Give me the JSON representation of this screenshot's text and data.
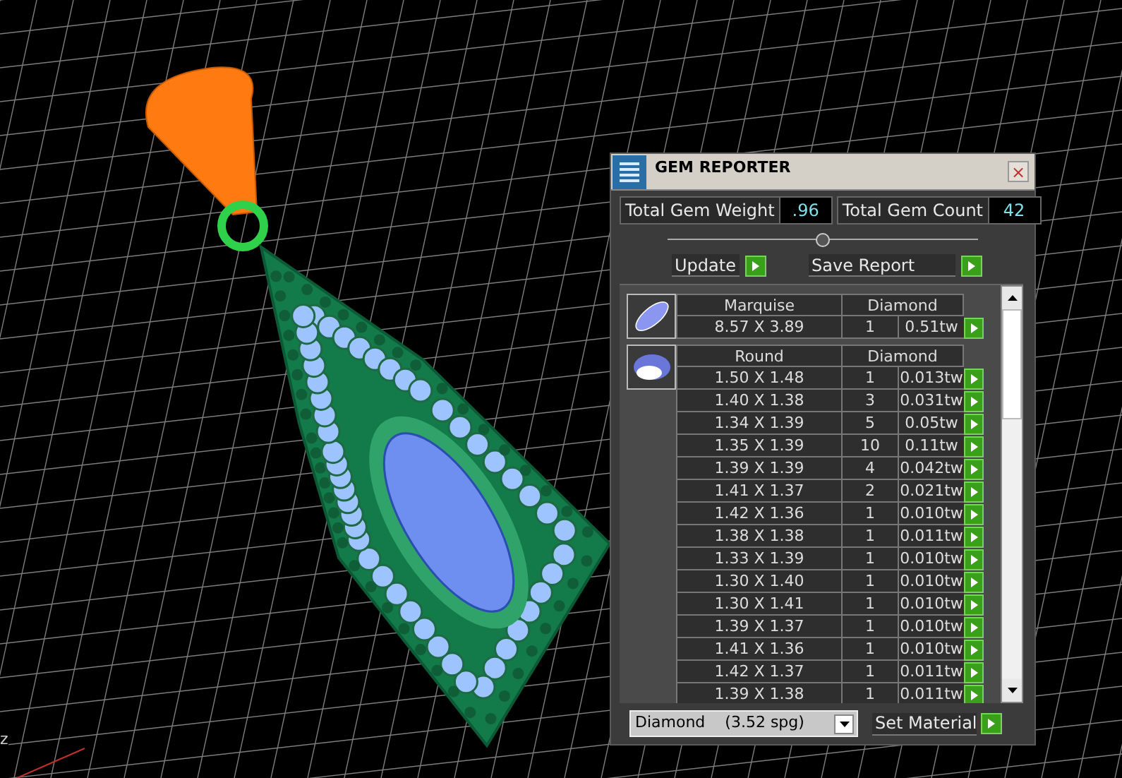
{
  "viewport": {
    "axis_label": "z"
  },
  "panel": {
    "title": "GEM REPORTER",
    "close": "×"
  },
  "totals": [
    {
      "label": "Total Gem Weight",
      "value": ".96"
    },
    {
      "label": "Total Gem Count",
      "value": "42"
    }
  ],
  "slider": {
    "level": 0.5
  },
  "actions": [
    {
      "label": "Update"
    },
    {
      "label": "Save Report"
    }
  ],
  "groups": [
    {
      "shape": "Marquise",
      "material": "Diamond",
      "kind": "marquise",
      "rows": [
        {
          "size": "8.57 X 3.89",
          "count": "1",
          "weight": "0.51tw"
        }
      ]
    },
    {
      "shape": "Round",
      "material": "Diamond",
      "kind": "round",
      "rows": [
        {
          "size": "1.50 X 1.48",
          "count": "1",
          "weight": "0.013tw"
        },
        {
          "size": "1.40 X 1.38",
          "count": "3",
          "weight": "0.031tw"
        },
        {
          "size": "1.34 X 1.39",
          "count": "5",
          "weight": "0.05tw"
        },
        {
          "size": "1.35 X 1.39",
          "count": "10",
          "weight": "0.11tw"
        },
        {
          "size": "1.39 X 1.39",
          "count": "4",
          "weight": "0.042tw"
        },
        {
          "size": "1.41 X 1.37",
          "count": "2",
          "weight": "0.021tw"
        },
        {
          "size": "1.42 X 1.36",
          "count": "1",
          "weight": "0.010tw"
        },
        {
          "size": "1.38 X 1.38",
          "count": "1",
          "weight": "0.011tw"
        },
        {
          "size": "1.33 X 1.39",
          "count": "1",
          "weight": "0.010tw"
        },
        {
          "size": "1.30 X 1.40",
          "count": "1",
          "weight": "0.010tw"
        },
        {
          "size": "1.30 X 1.41",
          "count": "1",
          "weight": "0.010tw"
        },
        {
          "size": "1.39 X 1.37",
          "count": "1",
          "weight": "0.010tw"
        },
        {
          "size": "1.41 X 1.36",
          "count": "1",
          "weight": "0.010tw"
        },
        {
          "size": "1.42 X 1.37",
          "count": "1",
          "weight": "0.011tw"
        },
        {
          "size": "1.39 X 1.38",
          "count": "1",
          "weight": "0.011tw"
        }
      ]
    }
  ],
  "material": {
    "name": "Diamond",
    "density": "(3.52 spg)",
    "button": "Set Material"
  }
}
